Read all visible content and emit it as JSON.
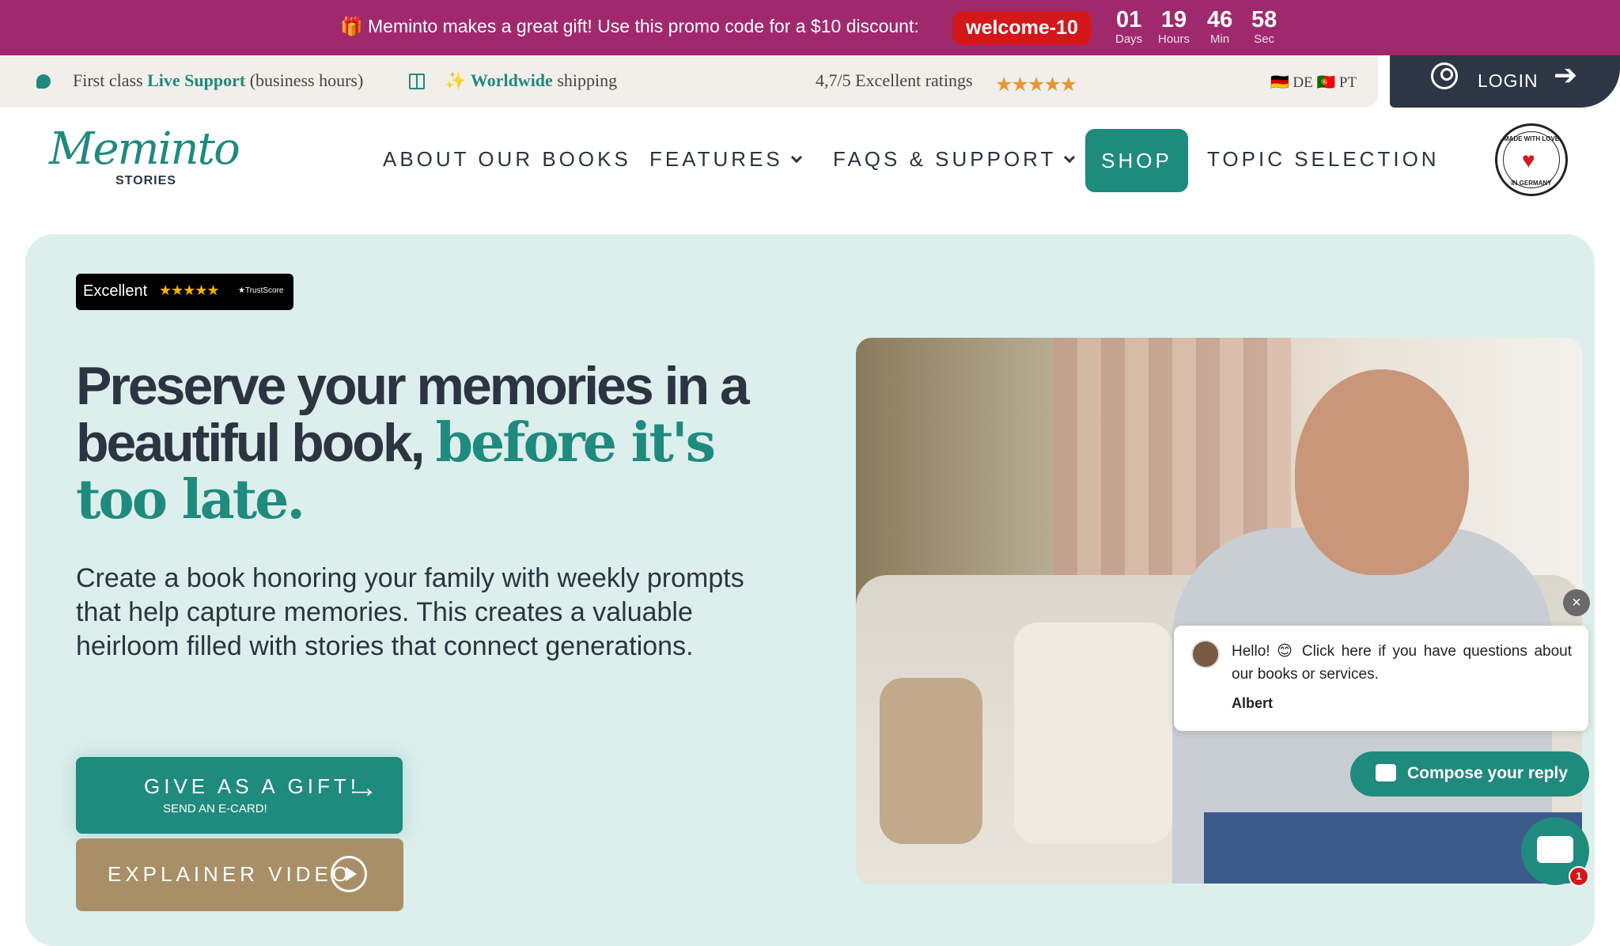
{
  "promo": {
    "text": "🎁 Meminto makes a great gift! Use this promo code for a $10 discount:",
    "code": "welcome-10",
    "countdown": [
      {
        "value": "01",
        "unit": "Days"
      },
      {
        "value": "19",
        "unit": "Hours"
      },
      {
        "value": "46",
        "unit": "Min"
      },
      {
        "value": "58",
        "unit": "Sec"
      }
    ]
  },
  "infobar": {
    "support_prefix": "First class",
    "support_bold": "Live Support",
    "support_suffix": "(business hours)",
    "shipping_prefix": "✨",
    "shipping_bold": "Worldwide",
    "shipping_suffix": "shipping",
    "ratings": "4,7/5 Excellent ratings",
    "stars": "★★★★★",
    "languages": "🇩🇪 DE 🇵🇹 PT"
  },
  "login": {
    "label": "LOGIN",
    "arrow": "➔"
  },
  "logo": {
    "script": "Meminto",
    "sub": "STORIES"
  },
  "nav": {
    "about": "ABOUT OUR BOOKS",
    "features": "FEATURES",
    "faqs": "FAQS & SUPPORT",
    "shop": "SHOP",
    "topics": "TOPIC SELECTION"
  },
  "badge": {
    "top": "MADE WITH LOVE",
    "bottom": "IN GERMANY",
    "heart": "♥"
  },
  "trustpilot": {
    "label": "Excellent",
    "stars": "★★★★★",
    "score": "★TrustScore"
  },
  "hero": {
    "headline_1": "Preserve your memories in a beautiful book,",
    "headline_highlight": "before it's too late.",
    "paragraph": "Create a book honoring your family with weekly prompts that help capture memories. This creates a valuable heirloom filled with stories that connect generations."
  },
  "buttons": {
    "gift": "GIVE AS A GIFT!",
    "gift_sub": "SEND AN E-CARD!",
    "gift_arrow": "→",
    "video": "EXPLAINER VIDEO"
  },
  "chat": {
    "close": "×",
    "message": "Hello! 😊 Click here if you have questions about our books or services.",
    "signature": "Albert",
    "compose": "Compose your reply",
    "unread": "1"
  },
  "colors": {
    "promo_bg": "#a0296e",
    "accent": "#1f8a7e",
    "hero_bg": "#dcefec",
    "dark": "#2c3644",
    "tan": "#a88f67",
    "red": "#d3171b"
  },
  "icons": [
    "chat-bubble-icon",
    "gift-box-icon",
    "user-icon",
    "arrow-right-icon",
    "chevron-down-icon",
    "play-icon",
    "message-icon",
    "close-icon"
  ]
}
